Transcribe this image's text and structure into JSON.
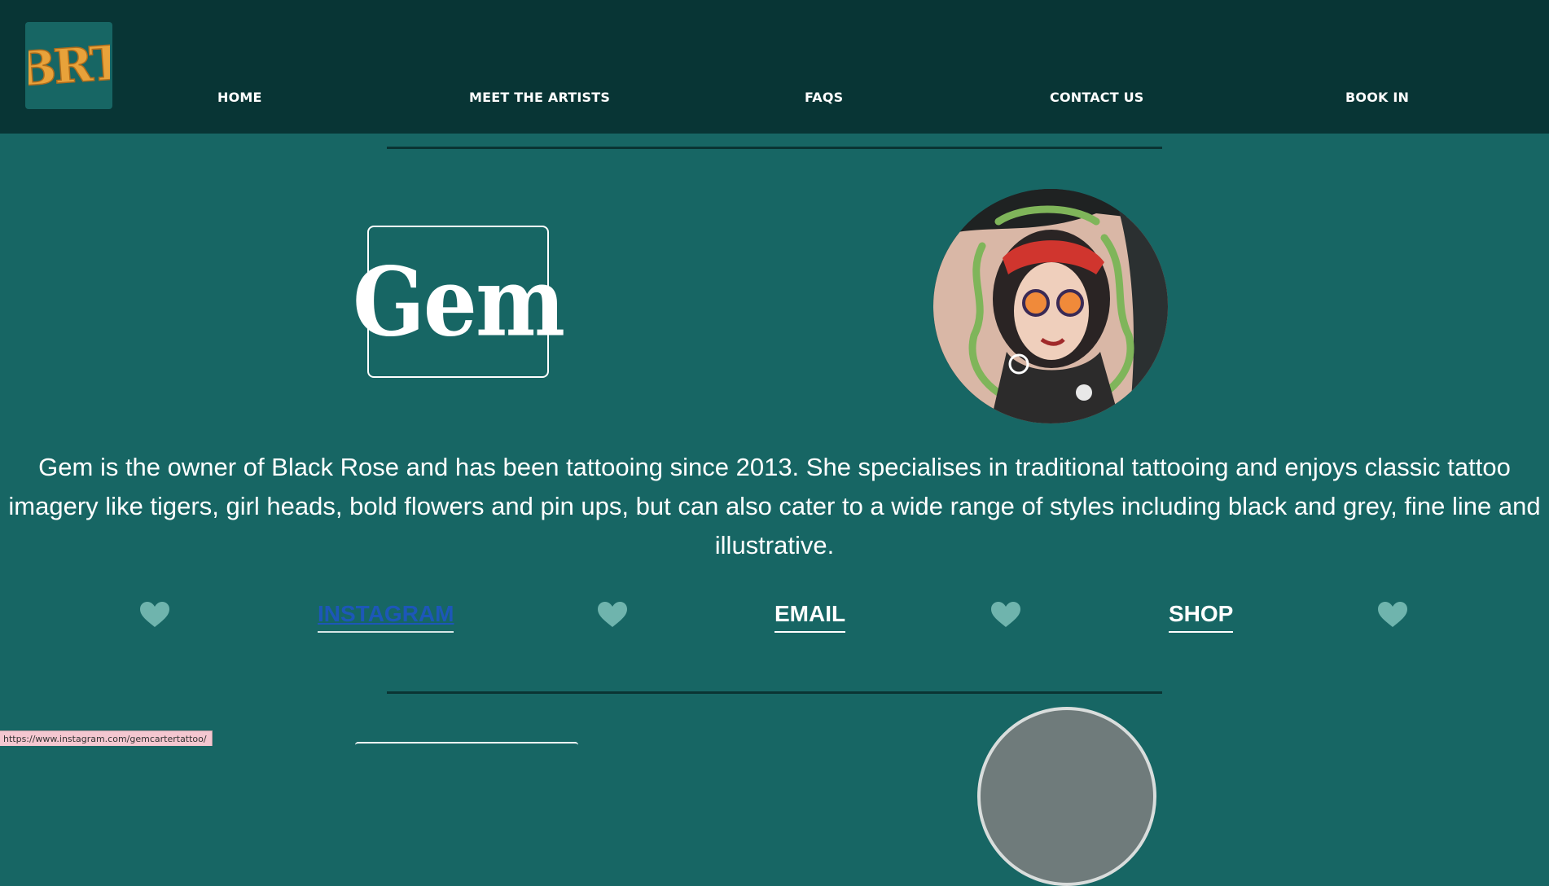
{
  "brand": {
    "logo_text": "BRT",
    "logo_color": "#e8a23a"
  },
  "nav": {
    "items": [
      {
        "label": "HOME"
      },
      {
        "label": "MEET THE ARTISTS"
      },
      {
        "label": "FAQS"
      },
      {
        "label": "CONTACT US"
      },
      {
        "label": "BOOK IN"
      }
    ]
  },
  "artist": {
    "name": "Gem",
    "portrait_icon": "tattoo-portrait-image",
    "bio": "Gem is the owner of Black Rose and has been tattooing since 2013. She specialises in traditional tattooing and enjoys classic tattoo imagery like tigers, girl heads, bold flowers and pin ups, but can also cater to a wide range of styles including black and grey, fine line and illustrative.",
    "links": [
      {
        "label": "INSTAGRAM"
      },
      {
        "label": "EMAIL"
      },
      {
        "label": "SHOP"
      }
    ]
  },
  "status_bar": {
    "url": "https://www.instagram.com/gemcartertattoo/"
  },
  "colors": {
    "header_bg": "#083535",
    "page_bg": "#176664",
    "heart": "#6fb4ad",
    "link_visited": "#1d57b8",
    "divider": "#0a3433"
  }
}
